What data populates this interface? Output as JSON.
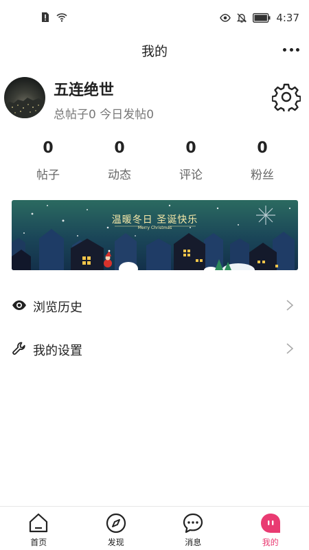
{
  "status_bar": {
    "time": "4:37"
  },
  "header": {
    "title": "我的"
  },
  "profile": {
    "username": "五连绝世",
    "stats_line": "总帖子0 今日发帖0"
  },
  "stats": [
    {
      "value": "0",
      "label": "帖子"
    },
    {
      "value": "0",
      "label": "动态"
    },
    {
      "value": "0",
      "label": "评论"
    },
    {
      "value": "0",
      "label": "粉丝"
    }
  ],
  "banner": {
    "title": "温暖冬日  圣诞快乐",
    "subtitle": "Merry Christmas"
  },
  "menu": [
    {
      "label": "浏览历史",
      "icon": "eye-icon"
    },
    {
      "label": "我的设置",
      "icon": "wrench-icon"
    }
  ],
  "tabbar": {
    "items": [
      {
        "label": "首页",
        "icon": "home-icon"
      },
      {
        "label": "发现",
        "icon": "compass-icon"
      },
      {
        "label": "消息",
        "icon": "chat-icon"
      },
      {
        "label": "我的",
        "icon": "profile-icon"
      }
    ],
    "active_index": 3,
    "active_color": "#e93b72"
  }
}
